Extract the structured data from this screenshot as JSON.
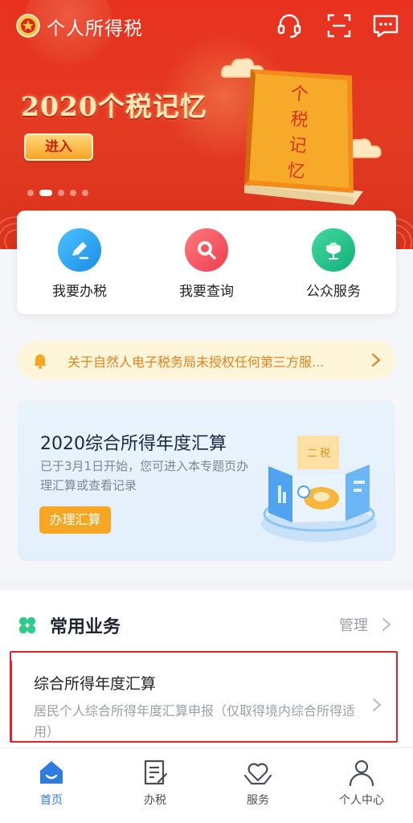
{
  "app": {
    "title": "个人所得税"
  },
  "banner": {
    "title": "2020个税记忆",
    "enter_label": "进入",
    "book_text": "个税记忆",
    "dots": 5,
    "active_dot": 1
  },
  "quick_actions": [
    {
      "label": "我要办税",
      "icon": "pen-icon",
      "color": "#2fa8f0"
    },
    {
      "label": "我要查询",
      "icon": "search-icon",
      "color": "#f25560"
    },
    {
      "label": "公众服务",
      "icon": "lotus-icon",
      "color": "#22c08a"
    }
  ],
  "notice": {
    "text": "关于自然人电子税务局未授权任何第三方服..."
  },
  "promo": {
    "title": "2020综合所得年度汇算",
    "subtitle": "已于3月1日开始，您可进入本专题页办理汇算或查看记录",
    "button": "办理汇算",
    "art_tag1": "二",
    "art_tag2": "税"
  },
  "section": {
    "title": "常用业务",
    "manage": "管理",
    "items": [
      {
        "title": "综合所得年度汇算",
        "desc": "居民个人综合所得年度汇算申报（仅取得境内综合所得适用）"
      }
    ]
  },
  "tabs": [
    {
      "label": "首页",
      "active": true
    },
    {
      "label": "办税",
      "active": false
    },
    {
      "label": "服务",
      "active": false
    },
    {
      "label": "个人中心",
      "active": false
    }
  ],
  "colors": {
    "brand_red": "#e33a22",
    "accent_blue": "#2f7de1",
    "orange": "#f6a623"
  }
}
